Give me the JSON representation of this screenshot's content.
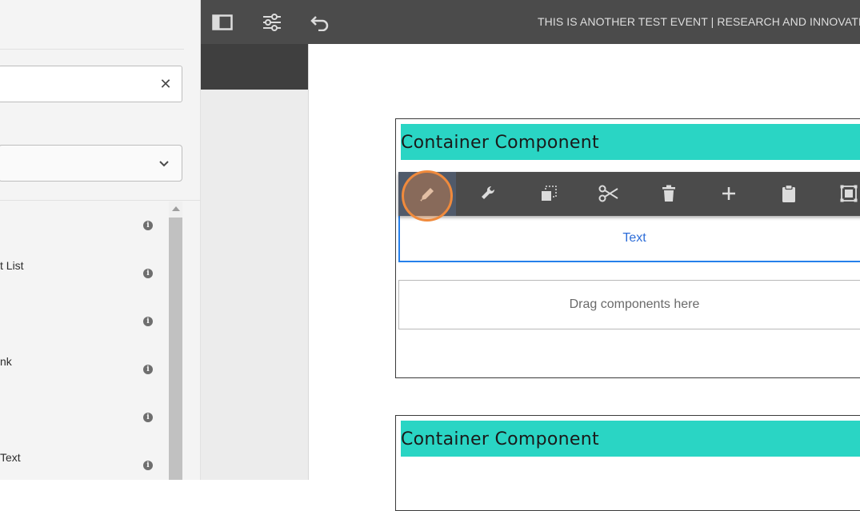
{
  "sidepanel": {
    "search": {
      "value": "",
      "placeholder": ""
    },
    "filter": {
      "selected": ""
    },
    "items": [
      {
        "label": ""
      },
      {
        "label": "t List"
      },
      {
        "label": ""
      },
      {
        "label": "nk"
      },
      {
        "label": ""
      },
      {
        "label": "Text"
      }
    ]
  },
  "topbar": {
    "page_title": "THIS IS ANOTHER TEST EVENT | RESEARCH AND INNOVATIO"
  },
  "canvas": {
    "container1_title": "Container Component",
    "text_component": "Text",
    "drag_placeholder": "Drag components here",
    "container2_title": "Container Component"
  },
  "colors": {
    "toolbar": "#4b4b4b",
    "teal": "#2ad5c4",
    "selection_blue": "#2680eb",
    "highlight": "#f08a3c"
  }
}
